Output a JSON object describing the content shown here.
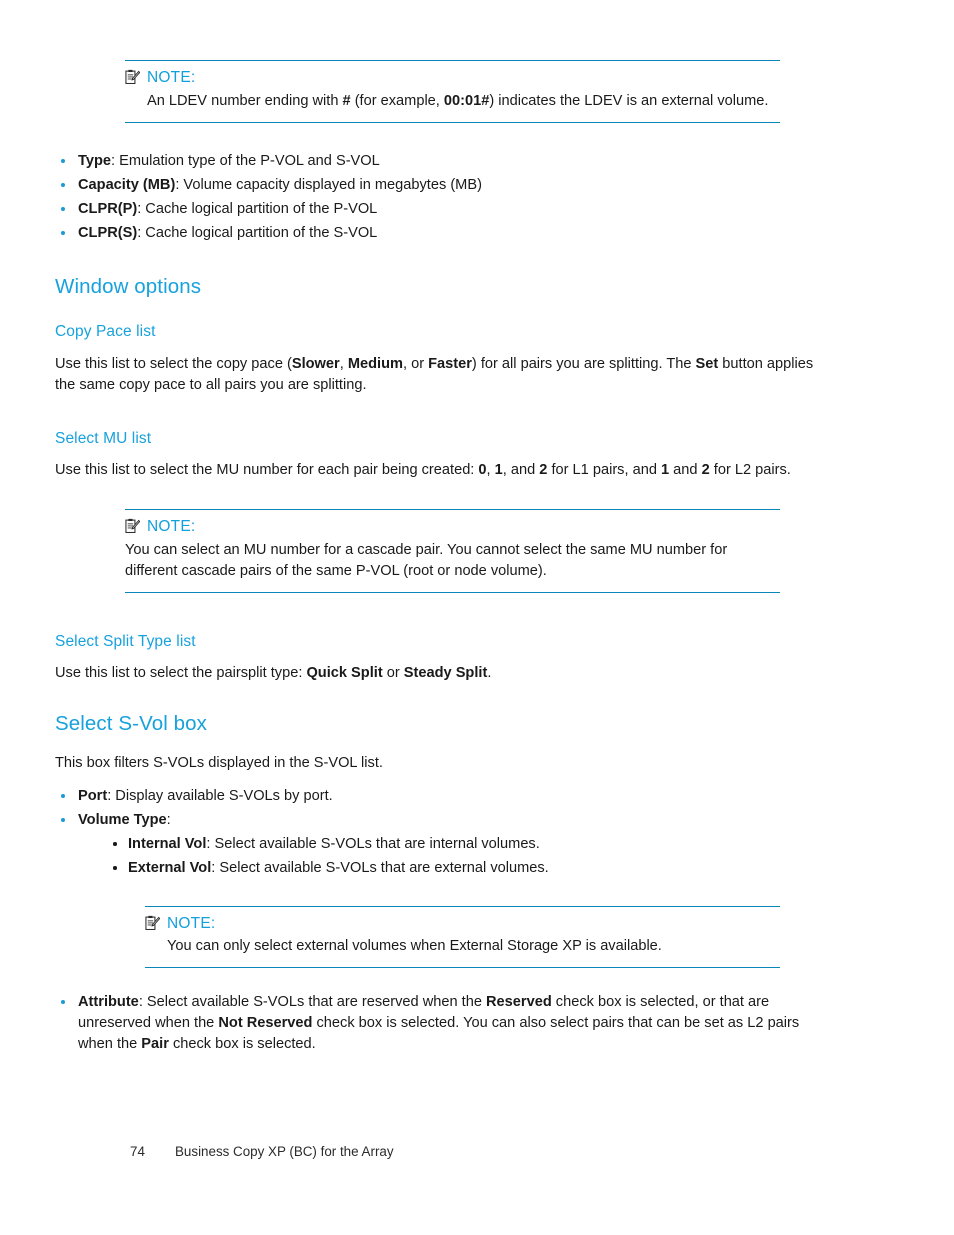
{
  "document": {
    "note_label": "NOTE:",
    "note_icon": "note-clipboard-pencil-icon"
  },
  "note_ldev": {
    "label": "NOTE:",
    "text_parts": {
      "a": "An LDEV number ending with ",
      "b": "#",
      "c": " (for example, ",
      "d": "00:01#",
      "e": ") indicates the LDEV is an external volume."
    }
  },
  "field_list": [
    {
      "term": "Type",
      "rest": ": Emulation type of the P-VOL and S-VOL"
    },
    {
      "term": "Capacity (MB)",
      "rest": ": Volume capacity displayed in megabytes (MB)"
    },
    {
      "term": "CLPR(P)",
      "rest": ": Cache logical partition of the P-VOL"
    },
    {
      "term": "CLPR(S)",
      "rest": ": Cache logical partition of the S-VOL"
    }
  ],
  "window_options": {
    "heading": "Window options"
  },
  "copy_pace": {
    "heading": "Copy Pace list",
    "p": {
      "a": "Use this list to select the copy pace (",
      "b": "Slower",
      "c": ", ",
      "d": "Medium",
      "e": ", or ",
      "f": "Faster",
      "g": ") for all pairs you are splitting. The ",
      "h": "Set",
      "i": " button applies the same copy pace to all pairs you are splitting."
    }
  },
  "select_mu": {
    "heading": "Select MU list",
    "p": {
      "a": "Use this list to select the MU number for each pair being created: ",
      "b": "0",
      "c": ", ",
      "d": "1",
      "e": ", and ",
      "f": "2",
      "g": " for L1 pairs, and ",
      "h": "1",
      "i": " and ",
      "j": "2",
      "k": " for L2 pairs."
    }
  },
  "note_cascade": {
    "label": "NOTE:",
    "text": "You can select an MU number for a cascade pair. You cannot select the same MU number for different cascade pairs of the same P-VOL (root or node volume)."
  },
  "select_split_type": {
    "heading": "Select Split Type list",
    "p": {
      "a": "Use this list to select the pairsplit type: ",
      "b": "Quick Split",
      "c": " or ",
      "d": "Steady Split",
      "e": "."
    }
  },
  "select_svol": {
    "heading": "Select S-Vol box",
    "intro": "This box filters S-VOLs displayed in the S-VOL list.",
    "bullets": [
      {
        "term": "Port",
        "rest": ": Display available S-VOLs by port."
      },
      {
        "term": "Volume Type",
        "rest": ":"
      }
    ],
    "sub_bullets": [
      {
        "term": "Internal Vol",
        "rest": ": Select available S-VOLs that are internal volumes."
      },
      {
        "term": "External Vol",
        "rest": ": Select available S-VOLs that are external volumes."
      }
    ],
    "note_external": {
      "label": "NOTE:",
      "text": "You can only select external volumes when External Storage XP is available."
    },
    "attribute": {
      "a": "Attribute",
      "b": ": Select available S-VOLs that are reserved when the ",
      "c": "Reserved",
      "d": " check box is selected, or that are unreserved when the ",
      "e": "Not Reserved",
      "f": " check box is selected. You can also select pairs that can be set as L2 pairs when the ",
      "g": "Pair",
      "h": " check box is selected."
    }
  },
  "footer": {
    "page_number": "74",
    "title": "Business Copy XP (BC) for the Array"
  },
  "colors": {
    "heading_blue": "#17a1dd",
    "rule_blue": "#0b86b8",
    "bullet_blue": "#1c9ad6",
    "body_text": "#1a1a1a"
  }
}
